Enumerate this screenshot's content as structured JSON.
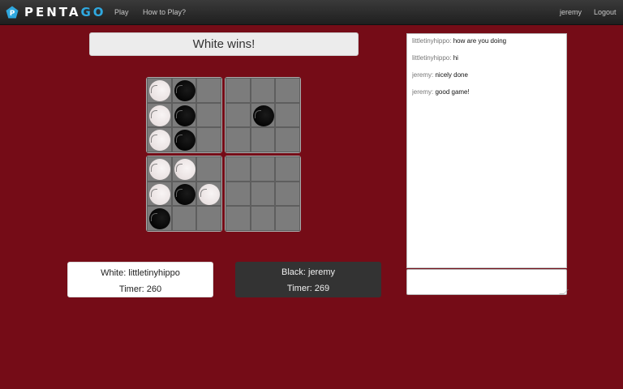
{
  "nav": {
    "brand_main": "PENTA",
    "brand_accent": "GO",
    "logo_letter": "P",
    "links": [
      "Play",
      "How to Play?"
    ],
    "user": "jeremy",
    "logout": "Logout"
  },
  "status": "White wins!",
  "board": {
    "quadrants": [
      [
        "white",
        "black",
        "",
        "white",
        "black",
        "",
        "white",
        "black",
        ""
      ],
      [
        "",
        "",
        "",
        "",
        "black",
        "",
        "",
        "",
        ""
      ],
      [
        "white",
        "white",
        "",
        "white",
        "black",
        "white",
        "black",
        "",
        ""
      ],
      [
        "",
        "",
        "",
        "",
        "",
        "",
        "",
        "",
        ""
      ]
    ]
  },
  "players": {
    "white": {
      "label": "White: littletinyhippo",
      "timer": "Timer: 260"
    },
    "black": {
      "label": "Black: jeremy",
      "timer": "Timer: 269"
    }
  },
  "chat": {
    "messages": [
      {
        "user": "littletinyhippo:",
        "text": "how are you doing"
      },
      {
        "user": "littletinyhippo:",
        "text": "hi"
      },
      {
        "user": "jeremy:",
        "text": "nicely done"
      },
      {
        "user": "jeremy:",
        "text": "good game!"
      }
    ],
    "input_value": ""
  },
  "colors": {
    "background": "#750c17",
    "accent": "#2fa8df",
    "navbar": "#2b2b2b",
    "board": "#7a7a7a"
  }
}
